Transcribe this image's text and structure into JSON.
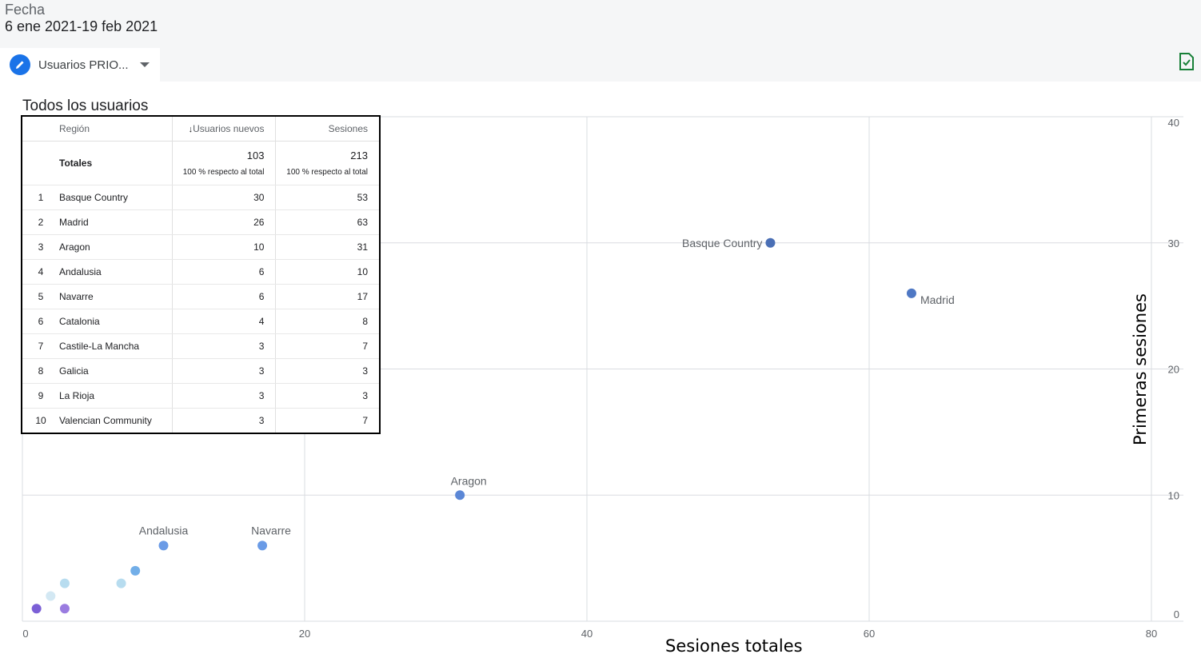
{
  "date_range": {
    "label": "Fecha",
    "value": "6 ene 2021-19 feb 2021"
  },
  "segment": {
    "label": "Usuarios PRIO...",
    "icon": "pencil-icon"
  },
  "export_icon": "document-check-icon",
  "section_title": "Todos los usuarios",
  "colors": {
    "accent": "#1a73e8",
    "export_green": "#188038",
    "table_border": "#000000"
  },
  "table": {
    "headers": {
      "region": "Región",
      "new_users": "Usuarios nuevos",
      "sessions": "Sesiones"
    },
    "sort_icon": "arrow-down-icon",
    "totals": {
      "label": "Totales",
      "new_users": "103",
      "new_users_pct": "100 % respecto al total",
      "sessions": "213",
      "sessions_pct": "100 % respecto al total"
    },
    "rows": [
      {
        "index": "1",
        "region": "Basque Country",
        "new_users": "30",
        "sessions": "53"
      },
      {
        "index": "2",
        "region": "Madrid",
        "new_users": "26",
        "sessions": "63"
      },
      {
        "index": "3",
        "region": "Aragon",
        "new_users": "10",
        "sessions": "31"
      },
      {
        "index": "4",
        "region": "Andalusia",
        "new_users": "6",
        "sessions": "10"
      },
      {
        "index": "5",
        "region": "Navarre",
        "new_users": "6",
        "sessions": "17"
      },
      {
        "index": "6",
        "region": "Catalonia",
        "new_users": "4",
        "sessions": "8"
      },
      {
        "index": "7",
        "region": "Castile-La Mancha",
        "new_users": "3",
        "sessions": "7"
      },
      {
        "index": "8",
        "region": "Galicia",
        "new_users": "3",
        "sessions": "3"
      },
      {
        "index": "9",
        "region": "La Rioja",
        "new_users": "3",
        "sessions": "3"
      },
      {
        "index": "10",
        "region": "Valencian Community",
        "new_users": "3",
        "sessions": "7"
      }
    ]
  },
  "chart_data": {
    "type": "scatter",
    "xlabel": "Sesiones totales",
    "ylabel": "Primeras sesiones",
    "xlim": [
      0,
      80
    ],
    "ylim": [
      0,
      40
    ],
    "xticks": [
      0,
      20,
      40,
      60,
      80
    ],
    "yticks": [
      0,
      10,
      20,
      30,
      40
    ],
    "grid": true,
    "points": [
      {
        "x": 53,
        "y": 30,
        "label": "Basque Country",
        "color": "#4a6fb5"
      },
      {
        "x": 63,
        "y": 26,
        "label": "Madrid",
        "color": "#4f78c4"
      },
      {
        "x": 31,
        "y": 10,
        "label": "Aragon",
        "color": "#5b87d6"
      },
      {
        "x": 10,
        "y": 6,
        "label": "Andalusia",
        "color": "#6a9be6"
      },
      {
        "x": 17,
        "y": 6,
        "label": "Navarre",
        "color": "#6a9be6"
      },
      {
        "x": 8,
        "y": 4,
        "label": "",
        "color": "#72aee8"
      },
      {
        "x": 7,
        "y": 3,
        "label": "",
        "color": "#b7dcef"
      },
      {
        "x": 3,
        "y": 3,
        "label": "",
        "color": "#b7dcef"
      },
      {
        "x": 2,
        "y": 2,
        "label": "",
        "color": "#d3e8f3"
      },
      {
        "x": 1,
        "y": 1,
        "label": "",
        "color": "#7b5fd6"
      },
      {
        "x": 3,
        "y": 1,
        "label": "",
        "color": "#9a7ce0"
      }
    ]
  }
}
